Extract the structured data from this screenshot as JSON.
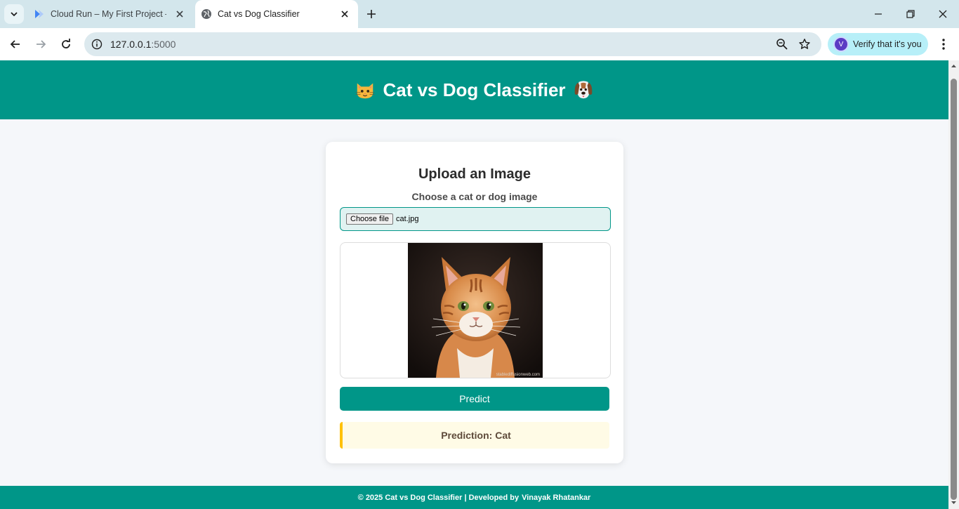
{
  "browser": {
    "tabs": [
      {
        "title": "Cloud Run – My First Project – G",
        "icon": "cloud-run-icon",
        "active": false
      },
      {
        "title": "Cat vs Dog Classifier",
        "icon": "globe-icon",
        "active": true
      }
    ],
    "url_host": "127.0.0.1",
    "url_port": ":5000",
    "verify_label": "Verify that it's you",
    "avatar_letter": "V"
  },
  "page": {
    "title": "Cat vs Dog Classifier",
    "card": {
      "heading": "Upload an Image",
      "label": "Choose a cat or dog image",
      "file_button": "Choose file",
      "file_name": "cat.jpg",
      "watermark": "stablediffusionweb.com",
      "predict_label": "Predict",
      "result_text": "Prediction: Cat"
    },
    "footer": {
      "text": "© 2025 Cat vs Dog Classifier | Developed by",
      "author": "Vinayak Rhatankar"
    }
  },
  "colors": {
    "primary": "#009688",
    "result_bg": "#fffbe6",
    "result_border": "#ffc107",
    "tabbar_bg": "#d3e6ec"
  }
}
